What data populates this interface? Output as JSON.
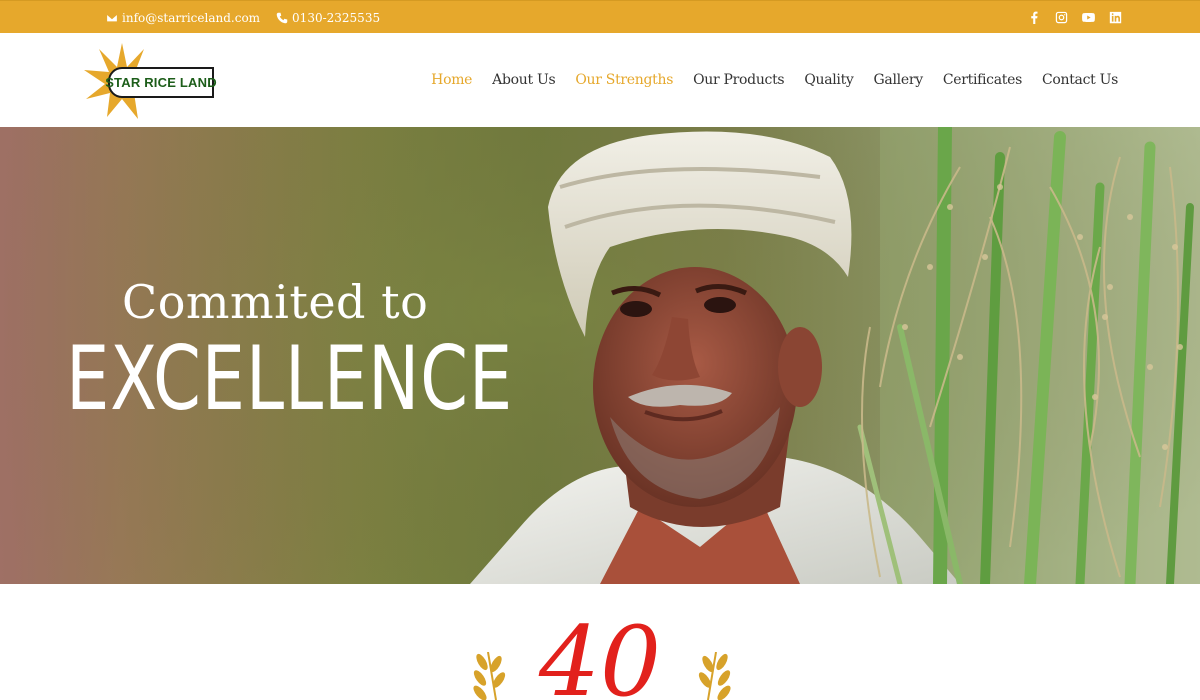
{
  "topbar": {
    "email": "info@starriceland.com",
    "phone": "0130-2325535",
    "social_icons": [
      "facebook-icon",
      "instagram-icon",
      "youtube-icon",
      "linkedin-icon"
    ],
    "background_color": "#e6a82c"
  },
  "logo": {
    "text": "STAR RICE LAND",
    "star_color": "#e6a82c",
    "text_color": "#1d5e1a"
  },
  "nav": {
    "items": [
      {
        "label": "Home",
        "active": true
      },
      {
        "label": "About Us",
        "active": false
      },
      {
        "label": "Our Strengths",
        "active": true
      },
      {
        "label": "Our Products",
        "active": false
      },
      {
        "label": "Quality",
        "active": false
      },
      {
        "label": "Gallery",
        "active": false
      },
      {
        "label": "Certificates",
        "active": false
      },
      {
        "label": "Contact Us",
        "active": false
      }
    ],
    "accent_color": "#e6a82c"
  },
  "hero": {
    "line1": "Commited to",
    "line2": "EXCELLENCE"
  },
  "years": {
    "number": "40",
    "number_color": "#e2211c"
  }
}
